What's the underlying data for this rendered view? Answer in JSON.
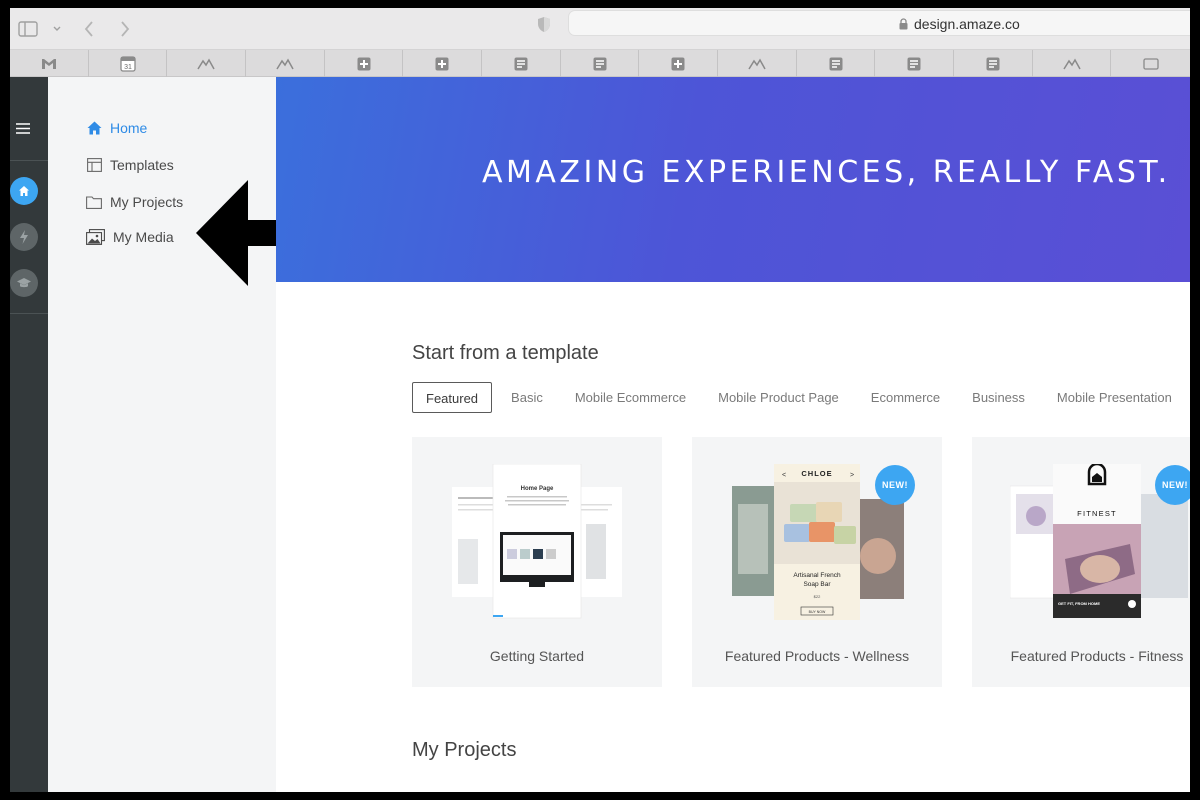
{
  "browser": {
    "url": "design.amaze.co",
    "bookmarks": [
      "gmail-icon",
      "calendar-icon",
      "mountain-icon",
      "mountain-icon",
      "plus-icon",
      "plus-icon",
      "doc-icon",
      "doc-icon",
      "plus-icon",
      "mountain-icon",
      "doc-icon",
      "doc-icon",
      "doc-icon",
      "mountain-icon",
      "window-icon"
    ],
    "calendar_day": "31"
  },
  "sidebar": {
    "items": [
      {
        "label": "Home",
        "icon": "home-icon",
        "active": true
      },
      {
        "label": "Templates",
        "icon": "template-icon",
        "active": false
      },
      {
        "label": "My Projects",
        "icon": "folder-icon",
        "active": false
      },
      {
        "label": "My Media",
        "icon": "media-icon",
        "active": false
      }
    ]
  },
  "hero": {
    "title": "AMAZING EXPERIENCES, REALLY FAST."
  },
  "templates": {
    "heading": "Start from a template",
    "tabs": [
      "Featured",
      "Basic",
      "Mobile Ecommerce",
      "Mobile Product Page",
      "Ecommerce",
      "Business",
      "Mobile Presentation"
    ],
    "cards": [
      {
        "label": "Getting Started",
        "new": false,
        "thumb_title": "Home Page"
      },
      {
        "label": "Featured Products - Wellness",
        "new": true,
        "thumb_brand": "CHLOE",
        "thumb_product": "Artisanal French Soap Bar",
        "thumb_price": "$22",
        "thumb_button": "BUY NOW"
      },
      {
        "label": "Featured Products - Fitness",
        "new": true,
        "thumb_brand": "FITNEST",
        "thumb_caption": "GET FIT, FROM HOME"
      }
    ],
    "badge_text": "NEW!"
  },
  "projects": {
    "heading": "My Projects"
  },
  "colors": {
    "accent": "#2e8be6",
    "hero_start": "#3b6fdc",
    "hero_end": "#5a4fd5",
    "badge": "#3da6f2",
    "rail": "#33393b"
  }
}
